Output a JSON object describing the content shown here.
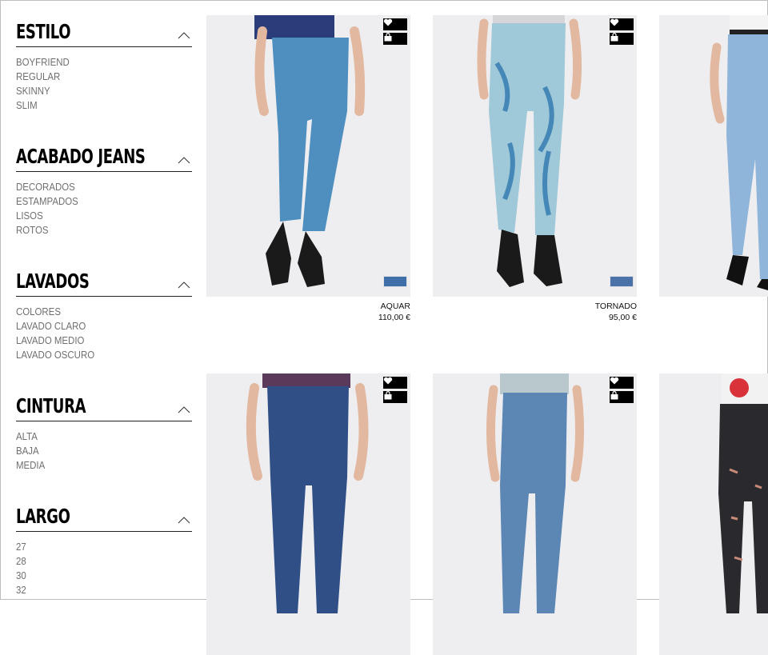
{
  "filters": [
    {
      "title": "ESTILO",
      "options": [
        "BOYFRIEND",
        "REGULAR",
        "SKINNY",
        "SLIM"
      ]
    },
    {
      "title": "ACABADO JEANS",
      "options": [
        "DECORADOS",
        "ESTAMPADOS",
        "LISOS",
        "ROTOS"
      ]
    },
    {
      "title": "LAVADOS",
      "options": [
        "COLORES",
        "LAVADO CLARO",
        "LAVADO MEDIO",
        "LAVADO OSCURO"
      ]
    },
    {
      "title": "CINTURA",
      "options": [
        "ALTA",
        "BAJA",
        "MEDIA"
      ]
    },
    {
      "title": "LARGO",
      "options": [
        "27",
        "28",
        "30",
        "32"
      ]
    }
  ],
  "icons": {
    "collapse": "chevron-up-icon",
    "wishlist": "heart-icon",
    "cart": "shopping-bag-icon"
  },
  "products": [
    {
      "name": "AQUAR",
      "price": "110,00 €",
      "denim": "#4f8fc0",
      "swatch": "#3f6fa8"
    },
    {
      "name": "TORNADO",
      "price": "95,00 €",
      "denim": "#9fc9d8",
      "swatch": "#4a72a8"
    },
    {
      "name": "",
      "price": "",
      "denim": "#8fb6da",
      "swatch": ""
    },
    {
      "name": "",
      "price": "",
      "denim": "#2f4f86",
      "swatch": ""
    },
    {
      "name": "",
      "price": "",
      "denim": "#5c86b4",
      "swatch": ""
    },
    {
      "name": "",
      "price": "",
      "denim": "#2a2a2e",
      "swatch": ""
    }
  ]
}
